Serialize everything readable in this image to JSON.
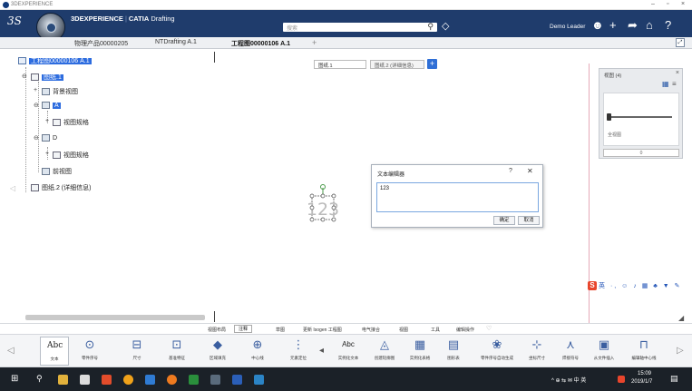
{
  "window": {
    "app_caption": "3DEXPERIENCE"
  },
  "header": {
    "brand_bold": "3DEXPERIENCE",
    "brand_separator": "|",
    "brand_catia": "CATIA",
    "brand_product": "Drafting",
    "search_placeholder": "搜索",
    "user_name": "Demo Leader"
  },
  "doc_tabs": [
    {
      "label": "物理产品00000205"
    },
    {
      "label": "NTDrafting A.1"
    },
    {
      "label": "工程图00000106 A.1"
    }
  ],
  "tree": {
    "root": "工程图00000106 A.1",
    "sheet1": "图纸.1",
    "background": "背景视图",
    "view_a": "A",
    "frame_a": "视图规格",
    "view_d": "D",
    "frame_d": "视图规格",
    "main_view": "前视图",
    "sheet2": "图纸.2 (详细信息)"
  },
  "sheet_tabs": [
    {
      "label": "图纸.1"
    },
    {
      "label": "图纸.2 (详细信息)"
    }
  ],
  "drawing": {
    "text_value": "123"
  },
  "dialog": {
    "title": "文本编辑器",
    "help": "?",
    "close": "✕",
    "text_value": "123",
    "ok_label": "确定",
    "cancel_label": "取消"
  },
  "right_panel": {
    "title": "视图 (4)",
    "caption": "全视图",
    "input_value": "0"
  },
  "ribbon_tabs": [
    {
      "label": "视图布局"
    },
    {
      "label": "注释"
    },
    {
      "label": "草图"
    },
    {
      "label": "更新 Isogen 工程图"
    },
    {
      "label": "电气接合"
    },
    {
      "label": "视图"
    },
    {
      "label": "工具"
    },
    {
      "label": "编辑操作"
    }
  ],
  "ribbon_tools": [
    {
      "label": "文本",
      "icon": "Abc"
    },
    {
      "label": "零件序号",
      "icon": "⊙"
    },
    {
      "label": "尺寸",
      "icon": "⊟"
    },
    {
      "label": "基准特征",
      "icon": "⊡"
    },
    {
      "label": "区域填充",
      "icon": "◆"
    },
    {
      "label": "中心线",
      "icon": "⊕"
    },
    {
      "label": "元素定位",
      "icon": "⋮"
    },
    {
      "label": "实例化文本",
      "icon": "Abc"
    },
    {
      "label": "创建轮廓图",
      "icon": "◬"
    },
    {
      "label": "实例化表格",
      "icon": "▦"
    },
    {
      "label": "图形表",
      "icon": "▤"
    },
    {
      "label": "零件序号自动生成",
      "icon": "❀"
    },
    {
      "label": "坐标尺寸",
      "icon": "⊹"
    },
    {
      "label": "焊接符号",
      "icon": "⋏"
    },
    {
      "label": "从文件插入",
      "icon": "▣"
    },
    {
      "label": "编辑轴中心线",
      "icon": "⊓"
    }
  ],
  "ime": {
    "brand": "S",
    "items": "英 ·, ☺ ♪ ▦ ♣ ▼ ✎"
  },
  "taskbar": {
    "time": "15:09",
    "date": "2019/1/7",
    "tray": "^ ⊕ ⇆ ✉ 中 英"
  },
  "colors": {
    "header_bg": "#1f3c6c",
    "selection": "#2d6cdf",
    "accent_blue": "#2f6fd6",
    "taskbar_bg": "#1b2128"
  }
}
